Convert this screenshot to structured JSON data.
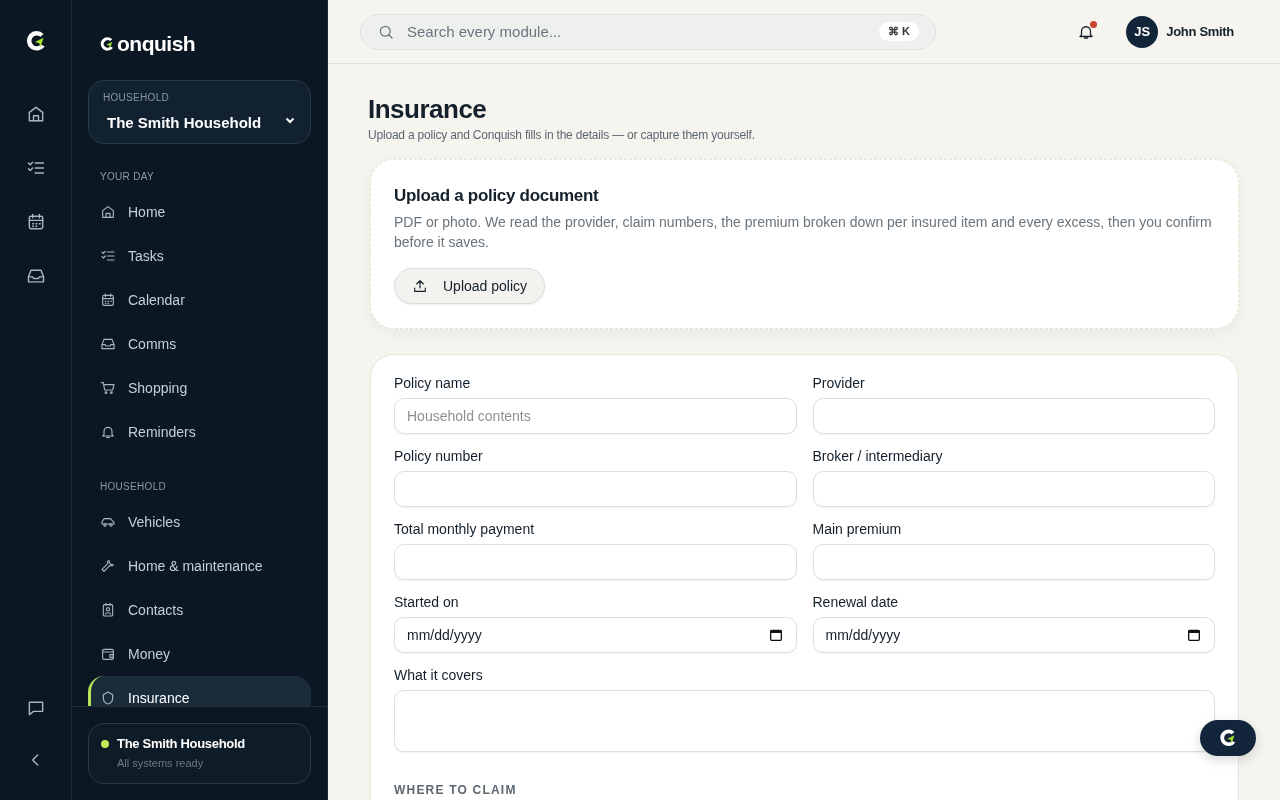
{
  "rail": {
    "items": [
      {
        "kind": "home"
      },
      {
        "kind": "tasks"
      },
      {
        "kind": "calendar"
      },
      {
        "kind": "inbox"
      }
    ],
    "bottom": [
      {
        "kind": "chat"
      },
      {
        "kind": "collapse"
      }
    ]
  },
  "sidebar": {
    "brand": "onquish",
    "household": {
      "label": "HOUSEHOLD",
      "value": "The Smith Household"
    },
    "sections": [
      {
        "title": "YOUR DAY",
        "items": [
          {
            "label": "Home",
            "kind": "home",
            "selected": false
          },
          {
            "label": "Tasks",
            "kind": "tasks",
            "selected": false
          },
          {
            "label": "Calendar",
            "kind": "calendar",
            "selected": false
          },
          {
            "label": "Comms",
            "kind": "inbox",
            "selected": false
          },
          {
            "label": "Shopping",
            "kind": "cart",
            "selected": false
          },
          {
            "label": "Reminders",
            "kind": "bell",
            "selected": false
          }
        ]
      },
      {
        "title": "HOUSEHOLD",
        "items": [
          {
            "label": "Vehicles",
            "kind": "car",
            "selected": false
          },
          {
            "label": "Home & maintenance",
            "kind": "wrench",
            "selected": false
          },
          {
            "label": "Contacts",
            "kind": "contact",
            "selected": false
          },
          {
            "label": "Money",
            "kind": "wallet",
            "selected": false
          },
          {
            "label": "Insurance",
            "kind": "shield",
            "selected": true
          }
        ]
      }
    ],
    "footer": {
      "name": "The Smith Household",
      "status": "All systems ready",
      "color": "#c3ec5c"
    }
  },
  "topbar": {
    "search": {
      "placeholder": "Search every module...",
      "shortcut": "⌘ K"
    },
    "notifications": {
      "unread": true
    },
    "user": {
      "initials": "JS",
      "name": "John Smith"
    }
  },
  "page": {
    "title": "Insurance",
    "subtitle": "Upload a policy and Conquish fills in the details — or capture them yourself."
  },
  "upload": {
    "title": "Upload a policy document",
    "description": "PDF or photo. We read the provider, claim numbers, the premium broken down per insured item and every excess, then you confirm before it saves.",
    "button": "Upload policy"
  },
  "form": {
    "fields": [
      {
        "label": "Policy name",
        "kind": "text",
        "placeholder": "Household contents"
      },
      {
        "label": "Provider",
        "kind": "text"
      },
      {
        "label": "Policy number",
        "kind": "text"
      },
      {
        "label": "Broker / intermediary",
        "kind": "text"
      },
      {
        "label": "Total monthly payment",
        "kind": "text"
      },
      {
        "label": "Main premium",
        "kind": "text"
      },
      {
        "label": "Started on",
        "kind": "date",
        "placeholder": "mm/dd/yyyy"
      },
      {
        "label": "Renewal date",
        "kind": "date",
        "placeholder": "mm/dd/yyyy"
      },
      {
        "label": "What it covers",
        "kind": "textarea"
      }
    ],
    "section": "WHERE TO CLAIM"
  }
}
